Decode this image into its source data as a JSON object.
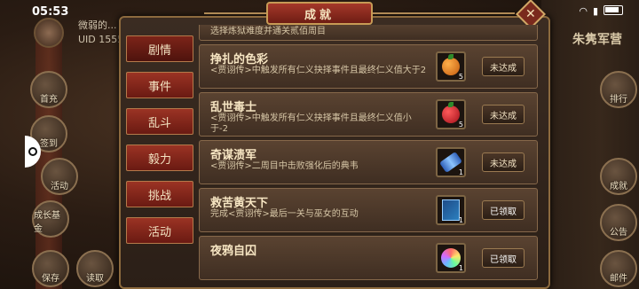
{
  "status_bar": {
    "time": "05:53",
    "battery": "battery"
  },
  "player": {
    "name": "微弱的...",
    "uid": "UID 1555"
  },
  "left_buttons": [
    {
      "label": "首充"
    },
    {
      "label": "签到"
    },
    {
      "label": "活动"
    },
    {
      "label": "成长基金"
    },
    {
      "label": "保存"
    },
    {
      "label": "读取"
    }
  ],
  "right_side": {
    "title": "朱隽军营",
    "buttons": [
      {
        "label": "排行"
      },
      {
        "label": "成就"
      },
      {
        "label": "公告"
      },
      {
        "label": "邮件"
      }
    ]
  },
  "dialog": {
    "title": "成就",
    "close_label": "✕",
    "tabs": [
      "剧情",
      "事件",
      "乱斗",
      "毅力",
      "挑战",
      "活动"
    ],
    "active_tab": "剧情",
    "achievements": [
      {
        "title": "",
        "desc": "选择炼狱难度并通关贰佰周目",
        "item": "item",
        "count": "",
        "status": ""
      },
      {
        "title": "挣扎的色彩",
        "desc": "<贾诩传>中触发所有仁义抉择事件且最终仁义值大于2",
        "item": "orange-fruit",
        "count": "5",
        "status": "未达成"
      },
      {
        "title": "乱世毒士",
        "desc": "<贾诩传>中触发所有仁义抉择事件且最终仁义值小于-2",
        "item": "red-fruit",
        "count": "5",
        "status": "未达成"
      },
      {
        "title": "奇谋溃军",
        "desc": "<贾诩传>二周目中击败强化后的典韦",
        "item": "scroll",
        "count": "1",
        "status": "未达成"
      },
      {
        "title": "救苦黄天下",
        "desc": "完成<贾诩传>最后一关与巫女的互动",
        "item": "book",
        "count": "1",
        "status": "已领取"
      },
      {
        "title": "夜鸦自囚",
        "desc": "",
        "item": "orb",
        "count": "1",
        "status": "已领取"
      }
    ]
  },
  "colors": {
    "accent": "#9b3324",
    "border": "#8c6a3e",
    "panel": "#3b2c22"
  }
}
